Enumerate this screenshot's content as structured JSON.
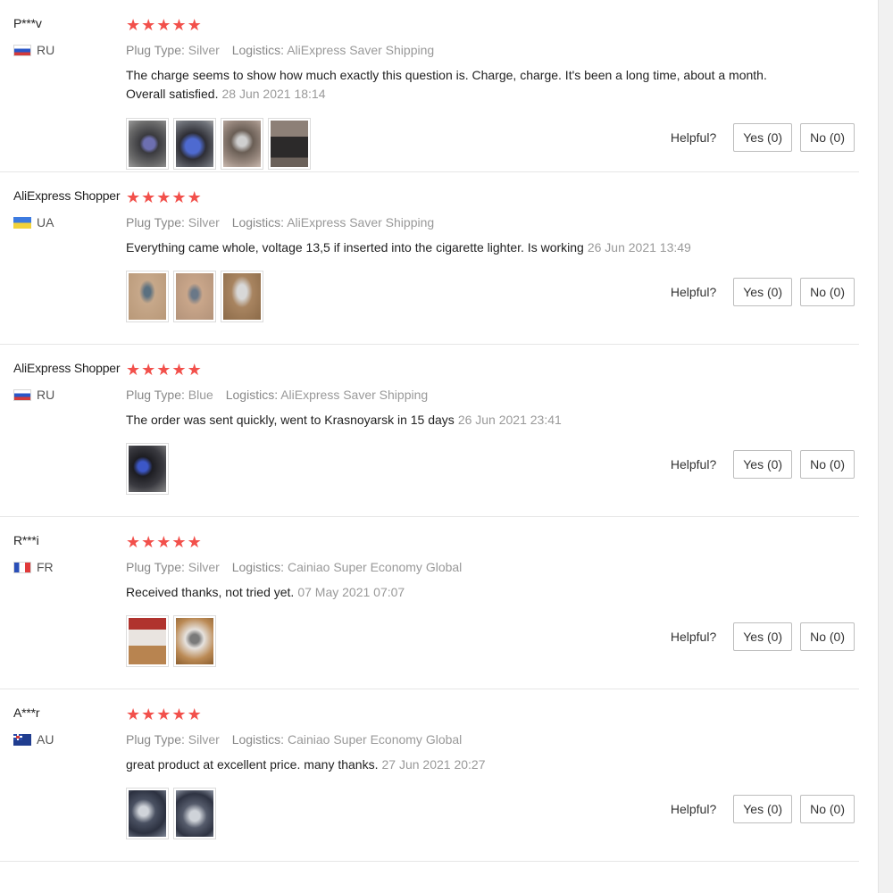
{
  "helpful_label": "Helpful?",
  "plug_type_label": "Plug Type:",
  "logistics_label": "Logistics:",
  "reviews": [
    {
      "user": "P***v",
      "country": "RU",
      "rating": 5,
      "plug_type": "Silver",
      "logistics": "AliExpress Saver Shipping",
      "text": "The charge seems to show how much exactly this question is. Charge, charge. It's been a long time, about a month. Overall satisfied.",
      "date": "28 Jun 2021 18:14",
      "yes": "Yes (0)",
      "no": "No (0)"
    },
    {
      "user": "AliExpress Shopper",
      "country": "UA",
      "rating": 5,
      "plug_type": "Silver",
      "logistics": "AliExpress Saver Shipping",
      "text": "Everything came whole, voltage 13,5 if inserted into the cigarette lighter. Is working",
      "date": "26 Jun 2021 13:49",
      "yes": "Yes (0)",
      "no": "No (0)"
    },
    {
      "user": "AliExpress Shopper",
      "country": "RU",
      "rating": 5,
      "plug_type": "Blue",
      "logistics": "AliExpress Saver Shipping",
      "text": "The order was sent quickly, went to Krasnoyarsk in 15 days",
      "date": "26 Jun 2021 23:41",
      "yes": "Yes (0)",
      "no": "No (0)"
    },
    {
      "user": "R***i",
      "country": "FR",
      "rating": 5,
      "plug_type": "Silver",
      "logistics": "Cainiao Super Economy Global",
      "text": "Received thanks, not tried yet.",
      "date": "07 May 2021 07:07",
      "yes": "Yes (0)",
      "no": "No (0)"
    },
    {
      "user": "A***r",
      "country": "AU",
      "rating": 5,
      "plug_type": "Silver",
      "logistics": "Cainiao Super Economy Global",
      "text": "great product at excellent price. many thanks.",
      "date": "27 Jun 2021 20:27",
      "yes": "Yes (0)",
      "no": "No (0)"
    }
  ],
  "colors": {
    "star": "#f2504b",
    "muted_text": "#999999",
    "divider": "#e6e6e6"
  }
}
